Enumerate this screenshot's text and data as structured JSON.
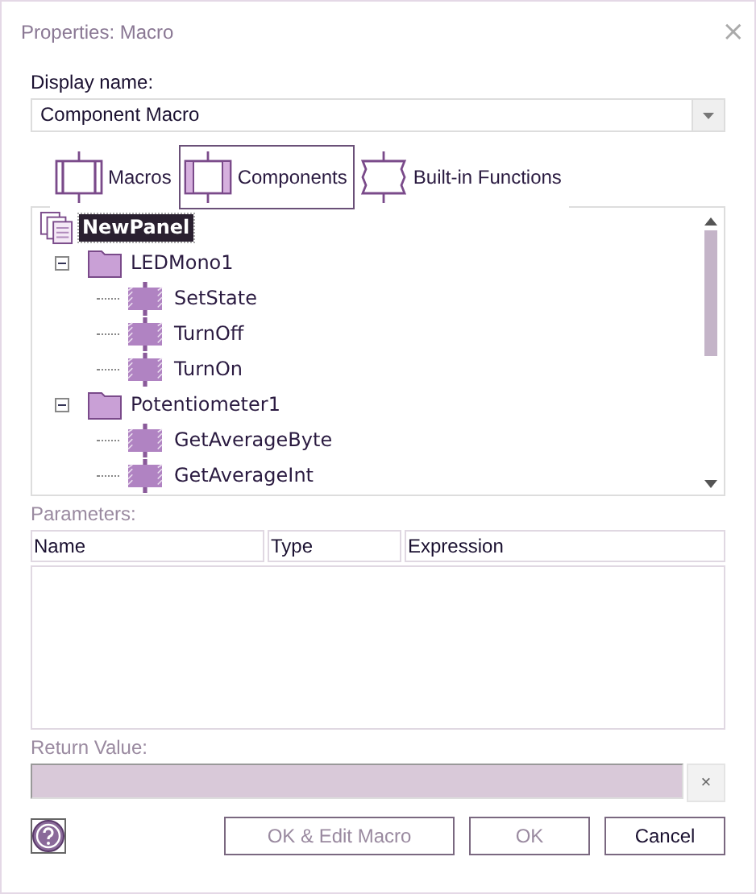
{
  "window": {
    "title": "Properties: Macro",
    "close": "×"
  },
  "display_name": {
    "label": "Display name:",
    "value": "Component Macro"
  },
  "tabs": [
    {
      "label": "Macros",
      "kind": "macros",
      "selected": false
    },
    {
      "label": "Components",
      "kind": "components",
      "selected": true
    },
    {
      "label": "Built-in Functions",
      "kind": "functions",
      "selected": false
    }
  ],
  "tree": [
    {
      "label": "NewPanel",
      "kind": "panel",
      "selected": true,
      "children": [
        {
          "label": "LEDMono1",
          "kind": "folder",
          "selected": false,
          "expanded": true,
          "children": [
            {
              "label": "SetState",
              "kind": "macro",
              "selected": false
            },
            {
              "label": "TurnOff",
              "kind": "macro",
              "selected": false
            },
            {
              "label": "TurnOn",
              "kind": "macro",
              "selected": false
            }
          ]
        },
        {
          "label": "Potentiometer1",
          "kind": "folder",
          "selected": false,
          "expanded": true,
          "children": [
            {
              "label": "GetAverageByte",
              "kind": "macro",
              "selected": false
            },
            {
              "label": "GetAverageInt",
              "kind": "macro",
              "selected": false
            }
          ]
        }
      ]
    }
  ],
  "parameters": {
    "label": "Parameters:",
    "columns": [
      "Name",
      "Type",
      "Expression"
    ]
  },
  "return_value": {
    "label": "Return Value:",
    "clear": "×"
  },
  "buttons": [
    {
      "label": "OK & Edit Macro",
      "disabled": true
    },
    {
      "label": "OK",
      "disabled": true
    },
    {
      "label": "Cancel",
      "disabled": false
    }
  ]
}
